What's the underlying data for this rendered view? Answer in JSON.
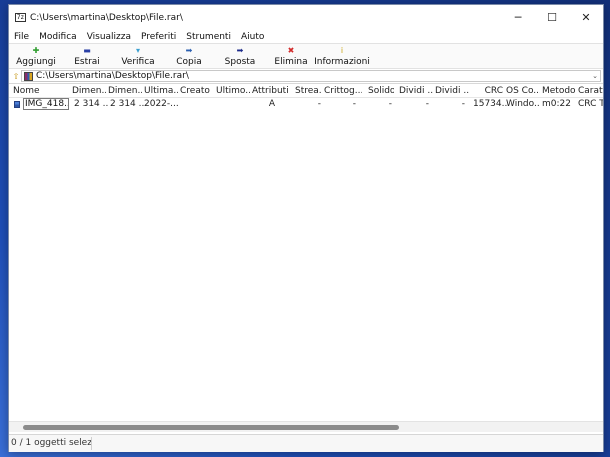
{
  "window": {
    "title": "C:\\Users\\martina\\Desktop\\File.rar\\",
    "app_icon_text": "7z"
  },
  "controls": {
    "minimize": "─",
    "maximize": "☐",
    "close": "✕"
  },
  "menu": [
    "File",
    "Modifica",
    "Visualizza",
    "Preferiti",
    "Strumenti",
    "Aiuto"
  ],
  "toolbar": [
    {
      "label": "Aggiungi",
      "icon": "plus-icon",
      "glyph": "✚",
      "color": "#2f9e2f"
    },
    {
      "label": "Estrai",
      "icon": "minus-icon",
      "glyph": "▬",
      "color": "#2a3fa5"
    },
    {
      "label": "Verifica",
      "icon": "check-icon",
      "glyph": "▾",
      "color": "#3a9fd0"
    },
    {
      "label": "Copia",
      "icon": "copy-arrow-icon",
      "glyph": "➡",
      "color": "#2a5fb0"
    },
    {
      "label": "Sposta",
      "icon": "move-arrow-icon",
      "glyph": "➡",
      "color": "#1c2a8a"
    },
    {
      "label": "Elimina",
      "icon": "delete-x-icon",
      "glyph": "✖",
      "color": "#d22b2b"
    },
    {
      "label": "Informazioni",
      "icon": "info-icon",
      "glyph": "i",
      "color": "#c8a414"
    }
  ],
  "address": {
    "path": "C:\\Users\\martina\\Desktop\\File.rar\\",
    "dropdown": "⌄",
    "up_glyph": "⇧"
  },
  "columns": [
    "Nome",
    "Dimen...",
    "Dimen...",
    "Ultima...",
    "Creato",
    "Ultimo...",
    "Attributi",
    "Strea...",
    "Crittog...",
    "Solido",
    "Dividi ...",
    "Dividi ...",
    "CRC",
    "OS Co...",
    "Metodo",
    "Caratt"
  ],
  "rows": [
    [
      "IMG_418...",
      "2 314 ...",
      "2 314 ...",
      "2022-...",
      "",
      "",
      "A",
      "-",
      "-",
      "-",
      "-",
      "-",
      "15734...",
      "Windo...",
      "m0:22",
      "CRC T"
    ]
  ],
  "status": {
    "selection": "0 / 1 oggetti selezionati"
  }
}
